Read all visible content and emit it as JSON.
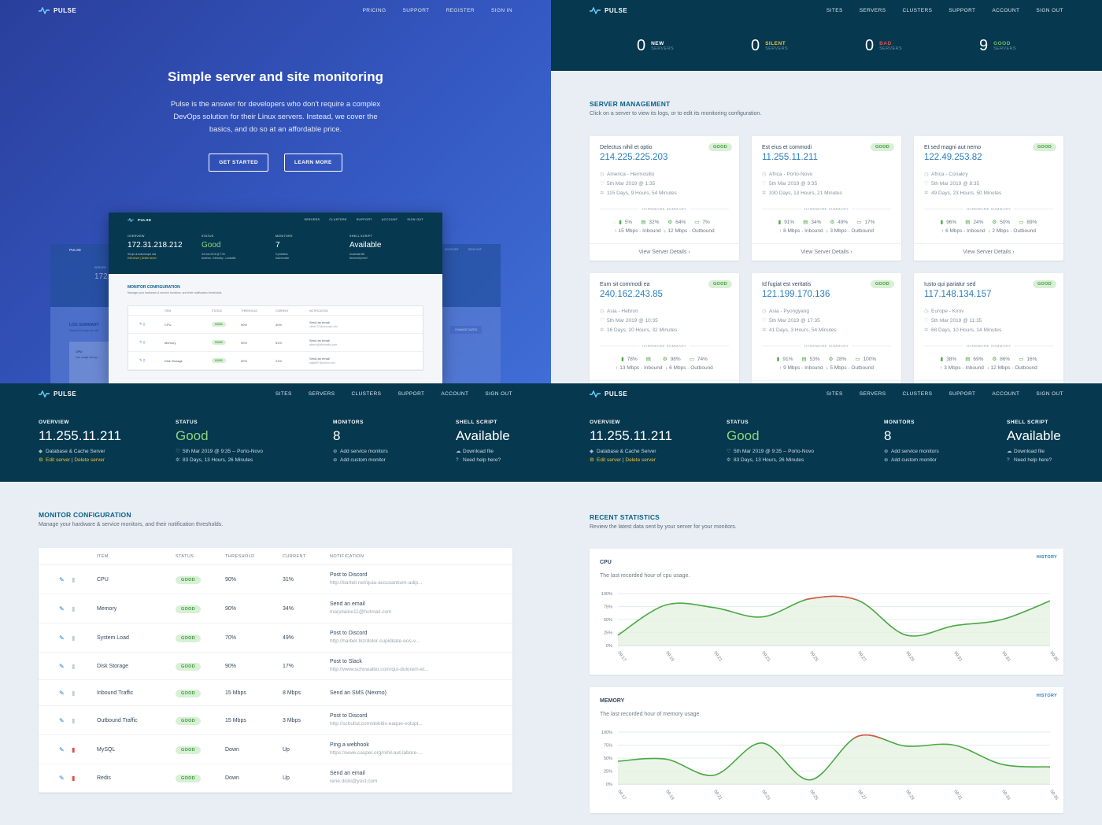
{
  "brand": {
    "name": "PULSE",
    "logo_icon": "pulse-wave-icon",
    "good_color": "#3f9b35",
    "bad_color": "#e0524a",
    "accent": "#0a5f8a"
  },
  "landing": {
    "nav": [
      "PRICING",
      "SUPPORT",
      "REGISTER",
      "SIGN IN"
    ],
    "title": "Simple server and site monitoring",
    "subtitle": "Pulse is the answer for developers who don't require a complex DevOps solution for their Linux servers. Instead, we cover the basics, and do so at an affordable price.",
    "buttons": {
      "get_started": "GET STARTED",
      "learn_more": "LEARN MORE"
    },
    "mockup": {
      "nav": [
        "SERVERS",
        "CLUSTERS",
        "SUPPORT",
        "ACCOUNT",
        "SIGN OUT"
      ],
      "overview_label": "OVERVIEW",
      "overview_ip": "172.31.218.212",
      "overview_l1": "Sit qui ut doloremque mai",
      "overview_l2": "Edit server | Delete server",
      "status_label": "STATUS",
      "status_value": "Good",
      "status_l1": "3rd Jan 2019 @ 7:54",
      "status_l2": "America - Kentucky - Louisville",
      "monitors_label": "MONITORS",
      "monitors_value": "7",
      "monitors_l1": "0 problems",
      "monitors_l2": "Add monitor",
      "shell_label": "SHELL SCRIPT",
      "shell_value": "Available",
      "shell_l1": "Download file",
      "shell_l2": "Need help here?",
      "section_title": "MONITOR CONFIGURATION",
      "section_desc": "Manage your hardware & service monitors, and their notification thresholds.",
      "headers": [
        "ITEM",
        "STATUS",
        "THRESHOLD",
        "CURRENT",
        "NOTIFICATION"
      ],
      "rows": [
        {
          "item": "CPU",
          "status": "GOOD",
          "threshold": "90%",
          "current": "40%",
          "n1": "Send an email",
          "n2": "cleve707@stroman.info"
        },
        {
          "item": "Memory",
          "status": "GOOD",
          "threshold": "90%",
          "current": "51%",
          "n1": "Send an email",
          "n2": "alldevl@abernathy.com"
        },
        {
          "item": "Disk Storage",
          "status": "GOOD",
          "threshold": "90%",
          "current": "21%",
          "n1": "Send an email",
          "n2": "adigel57@yahoo.com"
        }
      ],
      "back_server_label": "SERVER",
      "back_server_ip": "172.",
      "back_log_title": "LOG SUMMARY",
      "back_log_desc": "Search through the hist",
      "back_cpu": "CPU",
      "back_cpu_desc": "Cpu usage during t",
      "back_change_dates": "CHANGE DATES",
      "back_account": "ACCOUNT",
      "back_sign_out": "SIGN OUT"
    }
  },
  "dashboard": {
    "nav": [
      "SITES",
      "SERVERS",
      "CLUSTERS",
      "SUPPORT",
      "ACCOUNT",
      "SIGN OUT"
    ],
    "stats": [
      {
        "value": "0",
        "label": "NEW",
        "sub": "SERVERS",
        "color": "#ffffff"
      },
      {
        "value": "0",
        "label": "SILENT",
        "sub": "SERVERS",
        "color": "#f1c232"
      },
      {
        "value": "0",
        "label": "BAD",
        "sub": "SERVERS",
        "color": "#e0524a"
      },
      {
        "value": "9",
        "label": "GOOD",
        "sub": "SERVERS",
        "color": "#6fc35f"
      }
    ],
    "section_title": "SERVER MANAGEMENT",
    "section_desc": "Click on a server to view its logs, or to edit its monitoring configuration.",
    "hw_label": "HARDWARE SUMMARY",
    "details_label": "View Server Details",
    "servers": [
      {
        "name": "Delectus nihil et optio",
        "status": "GOOD",
        "ip": "214.225.225.203",
        "location": "America - Hermosillo",
        "date": "5th Mar 2019 @ 1:35",
        "uptime": "115 Days, 9 Hours, 54 Minutes",
        "u1": "5%",
        "u2": "32%",
        "u3": "64%",
        "u4": "7%",
        "inbound": "15 Mbps - Inbound",
        "outbound": "12 Mbps - Outbound"
      },
      {
        "name": "Est eius et commodi",
        "status": "GOOD",
        "ip": "11.255.11.211",
        "location": "Africa - Porto-Novo",
        "date": "5th Mar 2019 @ 9:35",
        "uptime": "330 Days, 13 Hours, 21 Minutes",
        "u1": "91%",
        "u2": "34%",
        "u3": "49%",
        "u4": "17%",
        "inbound": "8 Mbps - Inbound",
        "outbound": "3 Mbps - Outbound"
      },
      {
        "name": "Et sed magni aut nemo",
        "status": "GOOD",
        "ip": "122.49.253.82",
        "location": "Africa - Conakry",
        "date": "5th Mar 2019 @ 8:35",
        "uptime": "49 Days, 23 Hours, 50 Minutes",
        "u1": "96%",
        "u2": "24%",
        "u3": "50%",
        "u4": "89%",
        "inbound": "6 Mbps - Inbound",
        "outbound": "2 Mbps - Outbound"
      },
      {
        "name": "Eum sit commodi ea",
        "status": "GOOD",
        "ip": "240.162.243.85",
        "location": "Asia - Hebron",
        "date": "5th Mar 2019 @ 10:35",
        "uptime": "16 Days, 20 Hours, 32 Minutes",
        "u1": "78%",
        "u2": "",
        "u3": "98%",
        "u4": "74%",
        "inbound": "13 Mbps - Inbound",
        "outbound": "6 Mbps - Outbound"
      },
      {
        "name": "Id fugiat est veritatis",
        "status": "GOOD",
        "ip": "121.199.170.136",
        "location": "Asia - Pyongyang",
        "date": "5th Mar 2019 @ 17:35",
        "uptime": "41 Days, 3 Hours, 54 Minutes",
        "u1": "91%",
        "u2": "53%",
        "u3": "28%",
        "u4": "100%",
        "inbound": "9 Mbps - Inbound",
        "outbound": "5 Mbps - Outbound"
      },
      {
        "name": "Iusto qui pariatur sed",
        "status": "GOOD",
        "ip": "117.148.134.157",
        "location": "Europe - Kirov",
        "date": "5th Mar 2019 @ 11:35",
        "uptime": "68 Days, 10 Hours, 14 Minutes",
        "u1": "38%",
        "u2": "69%",
        "u3": "86%",
        "u4": "16%",
        "inbound": "3 Mbps - Inbound",
        "outbound": "12 Mbps - Outbound"
      }
    ]
  },
  "server": {
    "nav": [
      "SITES",
      "SERVERS",
      "CLUSTERS",
      "SUPPORT",
      "ACCOUNT",
      "SIGN OUT"
    ],
    "overview": {
      "label": "OVERVIEW",
      "ip": "11.255.11.211",
      "type": "Database & Cache Server",
      "edit": "Edit server",
      "sep": "|",
      "delete": "Delete server"
    },
    "status": {
      "label": "STATUS",
      "value": "Good",
      "date": "5th Mar 2019 @ 9:35 -- Porto-Novo",
      "uptime": "83 Days, 13 Hours, 26 Minutes"
    },
    "monitors": {
      "label": "MONITORS",
      "value": "8",
      "add_service": "Add service monitors",
      "add_custom": "Add custom monitor"
    },
    "shell": {
      "label": "SHELL SCRIPT",
      "value": "Available",
      "download": "Download file",
      "help": "Need help here?"
    }
  },
  "monitor_config": {
    "title": "MONITOR CONFIGURATION",
    "desc": "Manage your hardware & service monitors, and their notification thresholds.",
    "headers": {
      "item": "ITEM",
      "status": "STATUS",
      "threshold": "THRESHOLD",
      "current": "CURRENT",
      "notification": "NOTIFICATION"
    },
    "rows": [
      {
        "item": "CPU",
        "status": "GOOD",
        "threshold": "90%",
        "current": "31%",
        "n1": "Post to Discord",
        "n2": "http://bartell.net/quia-accusantium-adip...",
        "delete_red": false
      },
      {
        "item": "Memory",
        "status": "GOOD",
        "threshold": "90%",
        "current": "34%",
        "n1": "Send an email",
        "n2": "marjolaine11@hotmail.com",
        "delete_red": false
      },
      {
        "item": "System Load",
        "status": "GOOD",
        "threshold": "70%",
        "current": "49%",
        "n1": "Post to Discord",
        "n2": "http://harber.biz/dolor-cupiditate-eos-v...",
        "delete_red": false
      },
      {
        "item": "Disk Storage",
        "status": "GOOD",
        "threshold": "90%",
        "current": "17%",
        "n1": "Post to Slack",
        "n2": "http://www.schowalter.com/qui-dolorem-et...",
        "delete_red": false
      },
      {
        "item": "Inbound Traffic",
        "status": "GOOD",
        "threshold": "15 Mbps",
        "current": "8 Mbps",
        "n1": "Send an SMS (Nexmo)",
        "n2": "",
        "delete_red": false
      },
      {
        "item": "Outbound Traffic",
        "status": "GOOD",
        "threshold": "15 Mbps",
        "current": "3 Mbps",
        "n1": "Post to Discord",
        "n2": "http://schulist.com/debitis-eaque-volupt...",
        "delete_red": false
      },
      {
        "item": "MySQL",
        "status": "GOOD",
        "threshold": "Down",
        "current": "Up",
        "n1": "Ping a webhook",
        "n2": "https://www.casper.org/nihil-aut-labore-...",
        "delete_red": true
      },
      {
        "item": "Redis",
        "status": "GOOD",
        "threshold": "Down",
        "current": "Up",
        "n1": "Send an email",
        "n2": "rene.dicki@yost.com",
        "delete_red": true
      }
    ]
  },
  "recent_stats": {
    "title": "RECENT STATISTICS",
    "desc": "Review the latest data sent by your server for your monitors.",
    "history_label": "HISTORY"
  },
  "chart_data": [
    {
      "type": "area",
      "title": "CPU",
      "subtitle": "The last recorded hour of cpu usage.",
      "x": [
        "09:17",
        "09:19",
        "09:21",
        "09:23",
        "09:25",
        "09:27",
        "09:29",
        "09:31",
        "09:33",
        "09:35"
      ],
      "y_ticks": [
        "0%",
        "25%",
        "50%",
        "75%",
        "100%"
      ],
      "ylim": [
        0,
        100
      ],
      "threshold": 90,
      "values": [
        20,
        78,
        73,
        55,
        90,
        87,
        20,
        38,
        50,
        86
      ],
      "line_color": "#4aa843",
      "over_threshold_color": "#e0524a",
      "grid": true
    },
    {
      "type": "area",
      "title": "MEMORY",
      "subtitle": "The last recorded hour of memory usage.",
      "x": [
        "09:17",
        "09:19",
        "09:21",
        "09:23",
        "09:25",
        "09:27",
        "09:29",
        "09:31",
        "09:33",
        "09:35"
      ],
      "y_ticks": [
        "0%",
        "25%",
        "50%",
        "75%",
        "100%"
      ],
      "ylim": [
        0,
        100
      ],
      "threshold": 90,
      "values": [
        44,
        48,
        17,
        79,
        8,
        92,
        73,
        75,
        38,
        33
      ],
      "line_color": "#4aa843",
      "over_threshold_color": "#e0524a",
      "grid": true
    }
  ]
}
